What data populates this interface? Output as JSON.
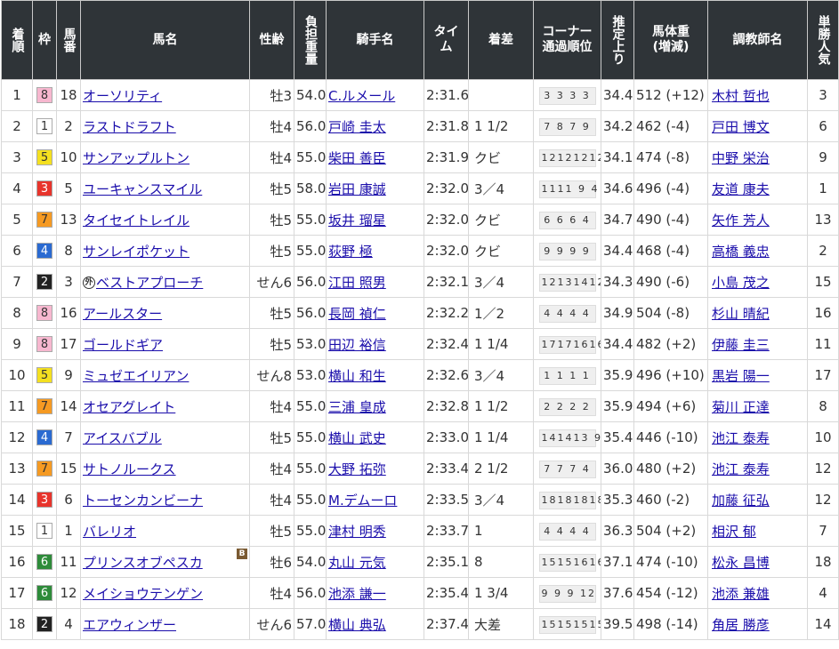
{
  "headers": {
    "rank": "着順",
    "frame": "枠",
    "num": "馬番",
    "horse": "馬名",
    "sexage": "性齢",
    "weight": "負担重量",
    "jockey": "騎手名",
    "time": "タイム",
    "margin": "着差",
    "corner": "コーナー通過順位",
    "last3f": "推定上り",
    "bodyweight": "馬体重(増減)",
    "trainer": "調教師名",
    "pop": "単勝人気"
  },
  "frame_colors": {
    "1": {
      "bg": "#ffffff",
      "fg": "#333333"
    },
    "2": {
      "bg": "#222222",
      "fg": "#ffffff"
    },
    "3": {
      "bg": "#e8342c",
      "fg": "#ffffff"
    },
    "4": {
      "bg": "#2a6ad1",
      "fg": "#ffffff"
    },
    "5": {
      "bg": "#f4e020",
      "fg": "#333333"
    },
    "6": {
      "bg": "#2e8b3a",
      "fg": "#ffffff"
    },
    "7": {
      "bg": "#f59a23",
      "fg": "#333333"
    },
    "8": {
      "bg": "#f7b7cf",
      "fg": "#333333"
    }
  },
  "rows": [
    {
      "rank": "1",
      "frame": "8",
      "num": "18",
      "horse": "オーソリティ",
      "mark": "",
      "blinker": "",
      "sexage": "牡3",
      "weight": "54.0",
      "jockey": "C.ルメール",
      "time": "2:31.6",
      "margin": "",
      "corner": "3 3 3 3",
      "last3f": "34.4",
      "bodyweight": "512 (+12)",
      "trainer": "木村 哲也",
      "pop": "3"
    },
    {
      "rank": "2",
      "frame": "1",
      "num": "2",
      "horse": "ラストドラフト",
      "mark": "",
      "blinker": "",
      "sexage": "牡4",
      "weight": "56.0",
      "jockey": "戸崎 圭太",
      "time": "2:31.8",
      "margin": "1 1/2",
      "corner": "7 8 7 9",
      "last3f": "34.2",
      "bodyweight": "462 (-4)",
      "trainer": "戸田 博文",
      "pop": "6"
    },
    {
      "rank": "3",
      "frame": "5",
      "num": "10",
      "horse": "サンアップルトン",
      "mark": "",
      "blinker": "",
      "sexage": "牡4",
      "weight": "55.0",
      "jockey": "柴田 善臣",
      "time": "2:31.9",
      "margin": "クビ",
      "corner": "12121212",
      "last3f": "34.1",
      "bodyweight": "474 (-8)",
      "trainer": "中野 栄治",
      "pop": "9"
    },
    {
      "rank": "4",
      "frame": "3",
      "num": "5",
      "horse": "ユーキャンスマイル",
      "mark": "",
      "blinker": "",
      "sexage": "牡5",
      "weight": "58.0",
      "jockey": "岩田 康誠",
      "time": "2:32.0",
      "margin": "3／4",
      "corner": "1111 9 4",
      "last3f": "34.6",
      "bodyweight": "496 (-4)",
      "trainer": "友道 康夫",
      "pop": "1"
    },
    {
      "rank": "5",
      "frame": "7",
      "num": "13",
      "horse": "タイセイトレイル",
      "mark": "",
      "blinker": "",
      "sexage": "牡5",
      "weight": "55.0",
      "jockey": "坂井 瑠星",
      "time": "2:32.0",
      "margin": "クビ",
      "corner": "6 6 6 4",
      "last3f": "34.7",
      "bodyweight": "490 (-4)",
      "trainer": "矢作 芳人",
      "pop": "13"
    },
    {
      "rank": "6",
      "frame": "4",
      "num": "8",
      "horse": "サンレイポケット",
      "mark": "",
      "blinker": "",
      "sexage": "牡5",
      "weight": "55.0",
      "jockey": "荻野 極",
      "time": "2:32.0",
      "margin": "クビ",
      "corner": "9 9 9 9",
      "last3f": "34.4",
      "bodyweight": "468 (-4)",
      "trainer": "高橋 義忠",
      "pop": "2"
    },
    {
      "rank": "7",
      "frame": "2",
      "num": "3",
      "horse": "ベストアプローチ",
      "mark": "外",
      "blinker": "",
      "sexage": "せん6",
      "weight": "56.0",
      "jockey": "江田 照男",
      "time": "2:32.1",
      "margin": "3／4",
      "corner": "12131412",
      "last3f": "34.3",
      "bodyweight": "490 (-6)",
      "trainer": "小島 茂之",
      "pop": "15"
    },
    {
      "rank": "8",
      "frame": "8",
      "num": "16",
      "horse": "アールスター",
      "mark": "",
      "blinker": "",
      "sexage": "牡5",
      "weight": "56.0",
      "jockey": "長岡 禎仁",
      "time": "2:32.2",
      "margin": "1／2",
      "corner": "4 4 4 4",
      "last3f": "34.9",
      "bodyweight": "504 (-8)",
      "trainer": "杉山 晴紀",
      "pop": "16"
    },
    {
      "rank": "9",
      "frame": "8",
      "num": "17",
      "horse": "ゴールドギア",
      "mark": "",
      "blinker": "",
      "sexage": "牡5",
      "weight": "53.0",
      "jockey": "田辺 裕信",
      "time": "2:32.4",
      "margin": "1 1/4",
      "corner": "17171616",
      "last3f": "34.4",
      "bodyweight": "482 (+2)",
      "trainer": "伊藤 圭三",
      "pop": "11"
    },
    {
      "rank": "10",
      "frame": "5",
      "num": "9",
      "horse": "ミュゼエイリアン",
      "mark": "",
      "blinker": "",
      "sexage": "せん8",
      "weight": "53.0",
      "jockey": "横山 和生",
      "time": "2:32.6",
      "margin": "3／4",
      "corner": "1 1 1 1",
      "last3f": "35.9",
      "bodyweight": "496 (+10)",
      "trainer": "黒岩 陽一",
      "pop": "17"
    },
    {
      "rank": "11",
      "frame": "7",
      "num": "14",
      "horse": "オセアグレイト",
      "mark": "",
      "blinker": "",
      "sexage": "牡4",
      "weight": "55.0",
      "jockey": "三浦 皇成",
      "time": "2:32.8",
      "margin": "1 1/2",
      "corner": "2 2 2 2",
      "last3f": "35.9",
      "bodyweight": "494 (+6)",
      "trainer": "菊川 正達",
      "pop": "8"
    },
    {
      "rank": "12",
      "frame": "4",
      "num": "7",
      "horse": "アイスバブル",
      "mark": "",
      "blinker": "",
      "sexage": "牡5",
      "weight": "55.0",
      "jockey": "横山 武史",
      "time": "2:33.0",
      "margin": "1 1/4",
      "corner": "141413 9",
      "last3f": "35.4",
      "bodyweight": "446 (-10)",
      "trainer": "池江 泰寿",
      "pop": "10"
    },
    {
      "rank": "13",
      "frame": "7",
      "num": "15",
      "horse": "サトノルークス",
      "mark": "",
      "blinker": "",
      "sexage": "牡4",
      "weight": "55.0",
      "jockey": "大野 拓弥",
      "time": "2:33.4",
      "margin": "2 1/2",
      "corner": "7 7 7 4",
      "last3f": "36.0",
      "bodyweight": "480 (+2)",
      "trainer": "池江 泰寿",
      "pop": "12"
    },
    {
      "rank": "14",
      "frame": "3",
      "num": "6",
      "horse": "トーセンカンビーナ",
      "mark": "",
      "blinker": "",
      "sexage": "牡4",
      "weight": "55.0",
      "jockey": "M.デムーロ",
      "time": "2:33.5",
      "margin": "3／4",
      "corner": "18181818",
      "last3f": "35.3",
      "bodyweight": "460 (-2)",
      "trainer": "加藤 征弘",
      "pop": "12"
    },
    {
      "rank": "15",
      "frame": "1",
      "num": "1",
      "horse": "バレリオ",
      "mark": "",
      "blinker": "",
      "sexage": "牡5",
      "weight": "55.0",
      "jockey": "津村 明秀",
      "time": "2:33.7",
      "margin": "1",
      "corner": "4 4 4 4",
      "last3f": "36.3",
      "bodyweight": "504 (+2)",
      "trainer": "相沢 郁",
      "pop": "7"
    },
    {
      "rank": "16",
      "frame": "6",
      "num": "11",
      "horse": "プリンスオブペスカ",
      "mark": "",
      "blinker": "B",
      "sexage": "牡6",
      "weight": "54.0",
      "jockey": "丸山 元気",
      "time": "2:35.1",
      "margin": "8",
      "corner": "15151616",
      "last3f": "37.1",
      "bodyweight": "474 (-10)",
      "trainer": "松永 昌博",
      "pop": "18"
    },
    {
      "rank": "17",
      "frame": "6",
      "num": "12",
      "horse": "メイショウテンゲン",
      "mark": "",
      "blinker": "",
      "sexage": "牡4",
      "weight": "56.0",
      "jockey": "池添 謙一",
      "time": "2:35.4",
      "margin": "1 3/4",
      "corner": "9 9 9 12",
      "last3f": "37.6",
      "bodyweight": "454 (-12)",
      "trainer": "池添 兼雄",
      "pop": "4"
    },
    {
      "rank": "18",
      "frame": "2",
      "num": "4",
      "horse": "エアウィンザー",
      "mark": "",
      "blinker": "",
      "sexage": "せん6",
      "weight": "57.0",
      "jockey": "横山 典弘",
      "time": "2:37.4",
      "margin": "大差",
      "corner": "15151515",
      "last3f": "39.5",
      "bodyweight": "498 (-14)",
      "trainer": "角居 勝彦",
      "pop": "14"
    }
  ]
}
